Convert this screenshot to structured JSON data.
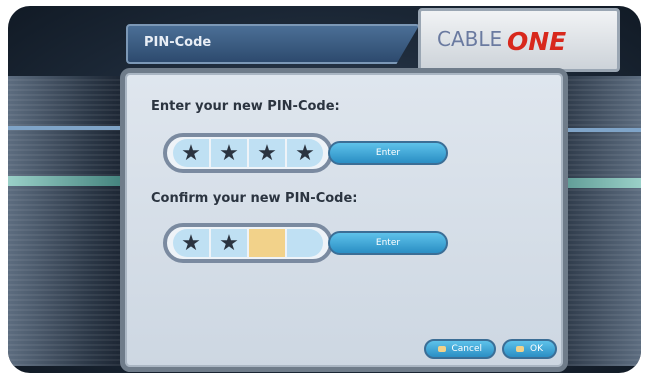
{
  "title_bar": {
    "label": "PIN-Code"
  },
  "logo": {
    "cable": "CABLE",
    "one": "ONE"
  },
  "form": {
    "new_pin_prompt": "Enter your new PIN-Code:",
    "confirm_pin_prompt": "Confirm your new PIN-Code:",
    "new_pin_cells": [
      "★",
      "★",
      "★",
      "★"
    ],
    "confirm_pin_cells": [
      "★",
      "★",
      "",
      ""
    ],
    "enter_label": "Enter"
  },
  "footer": {
    "cancel_label": "Cancel",
    "ok_label": "OK"
  }
}
